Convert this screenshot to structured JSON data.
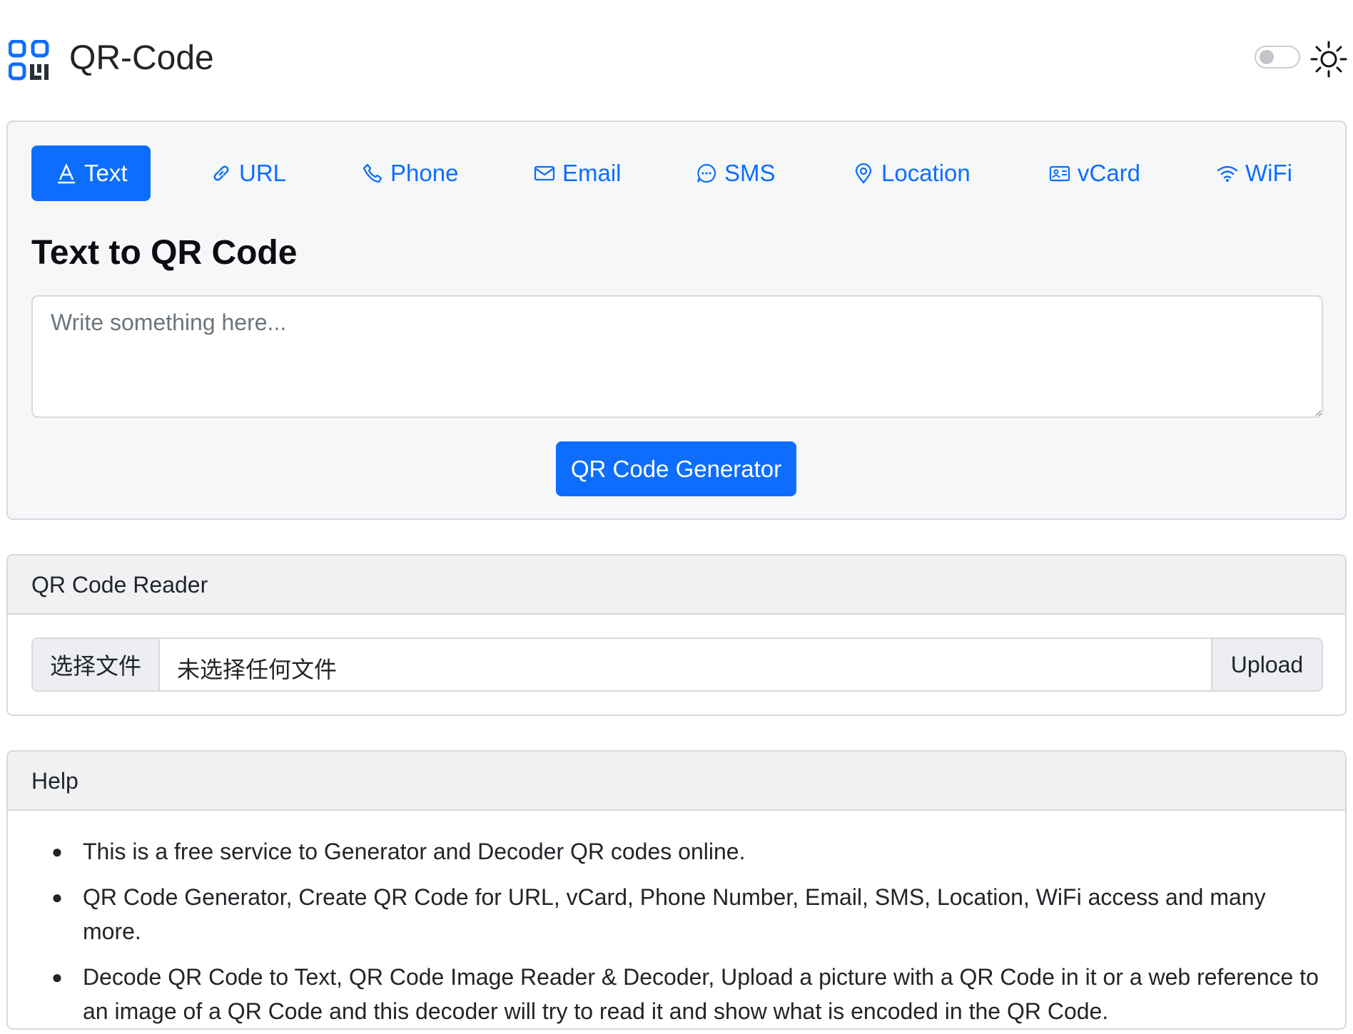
{
  "header": {
    "title": "QR-Code",
    "logo_icon": "qr-code-icon",
    "theme_toggle_icon": "toggle-switch-icon",
    "theme_icon": "sun-icon"
  },
  "tabs": [
    {
      "label": "Text",
      "icon": "font-icon",
      "active": true
    },
    {
      "label": "URL",
      "icon": "link-icon",
      "active": false
    },
    {
      "label": "Phone",
      "icon": "phone-icon",
      "active": false
    },
    {
      "label": "Email",
      "icon": "envelope-icon",
      "active": false
    },
    {
      "label": "SMS",
      "icon": "chat-dots-icon",
      "active": false
    },
    {
      "label": "Location",
      "icon": "geo-pin-icon",
      "active": false
    },
    {
      "label": "vCard",
      "icon": "person-vcard-icon",
      "active": false
    },
    {
      "label": "WiFi",
      "icon": "wifi-icon",
      "active": false
    }
  ],
  "generator": {
    "title": "Text to QR Code",
    "input_value": "",
    "input_placeholder": "Write something here...",
    "button_label": "QR Code Generator"
  },
  "reader": {
    "title": "QR Code Reader",
    "choose_label": "选择文件",
    "file_name": "未选择任何文件",
    "upload_label": "Upload"
  },
  "help": {
    "title": "Help",
    "items": [
      "This is a free service to Generator and Decoder QR codes online.",
      "QR Code Generator, Create QR Code for URL, vCard, Phone Number, Email, SMS, Location, WiFi access and many more.",
      "Decode QR Code to Text, QR Code Image Reader & Decoder, Upload a picture with a QR Code in it or a web reference to an image of a QR Code and this decoder will try to read it and show what is encoded in the QR Code."
    ]
  },
  "colors": {
    "accent": "#0d6efd",
    "card_bg": "#f6f7f9",
    "border": "#d6d9dd",
    "header_bg": "#f0f1f3"
  }
}
